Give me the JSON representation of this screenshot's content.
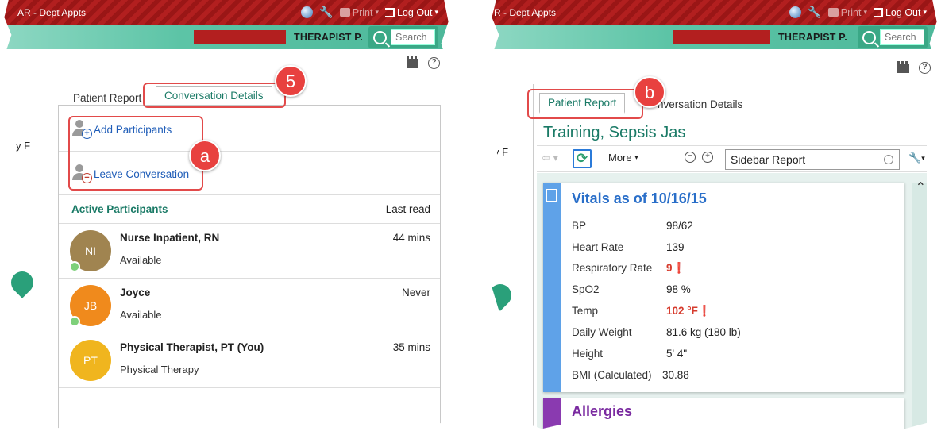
{
  "left": {
    "window_title": "AR - Dept Appts",
    "print_label": "Print",
    "logout_label": "Log Out",
    "user": "THERAPIST P.",
    "search_placeholder": "Search",
    "stub_text": "y F",
    "tabs": [
      "Patient Report",
      "Conversation Details"
    ],
    "badge_5": "5",
    "badge_a": "a",
    "actions": {
      "add": "Add Participants",
      "leave": "Leave Conversation"
    },
    "participants_header": {
      "title": "Active Participants",
      "last_read": "Last read"
    },
    "participants": [
      {
        "initials": "NI",
        "name": "Nurse Inpatient, RN",
        "status": "Available",
        "last_read": "44 mins",
        "color": "#a08450",
        "online": true
      },
      {
        "initials": "JB",
        "name": "Joyce",
        "status": "Available",
        "last_read": "Never",
        "color": "#f08a1c",
        "online": true
      },
      {
        "initials": "PT",
        "name": "Physical Therapist, PT (You)",
        "status": "Physical Therapy",
        "last_read": "35 mins",
        "color": "#f0b51e",
        "online": false
      }
    ]
  },
  "right": {
    "window_title": "R - Dept Appts",
    "print_label": "Print",
    "logout_label": "Log Out",
    "user": "THERAPIST P.",
    "search_placeholder": "Search",
    "stub_text": "y F",
    "tabs": [
      "Patient Report",
      "nversation Details"
    ],
    "badge_b": "b",
    "patient_name": "Training, Sepsis Jas",
    "toolbar": {
      "more": "More",
      "report_value": "Sidebar Report"
    },
    "vitals": {
      "title": "Vitals as of 10/16/15",
      "rows": [
        {
          "label": "BP",
          "value": "98/62",
          "alert": false
        },
        {
          "label": "Heart Rate",
          "value": "139",
          "alert": false
        },
        {
          "label": "Respiratory Rate",
          "value": "9❗",
          "alert": true
        },
        {
          "label": "SpO2",
          "value": "98 %",
          "alert": false
        },
        {
          "label": "Temp",
          "value": "102 °F❗",
          "alert": true
        },
        {
          "label": "Daily Weight",
          "value": "81.6 kg (180 lb)",
          "alert": false
        },
        {
          "label": "Height",
          "value": "5' 4\"",
          "alert": false
        },
        {
          "label": "BMI (Calculated)",
          "value": "30.88",
          "alert": false
        }
      ]
    },
    "allergies_title": "Allergies"
  },
  "colors": {
    "accent": "#1a7a66",
    "header_red": "#b21f1f",
    "callout": "#e24a4a",
    "link": "#1f5db8"
  }
}
